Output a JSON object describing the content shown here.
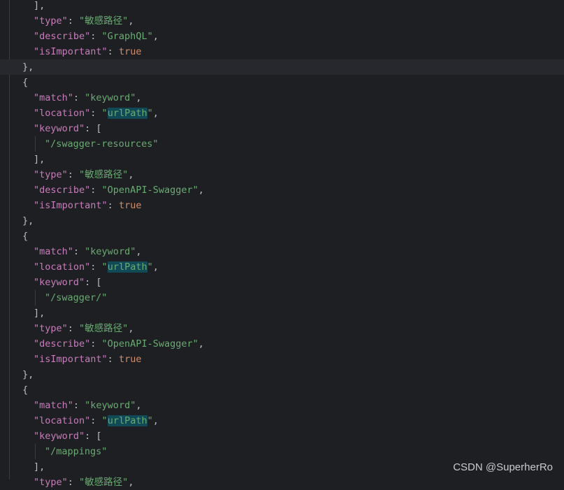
{
  "editor": {
    "lines": [
      {
        "indent": 1,
        "tokens": [
          {
            "t": "],",
            "c": "pun"
          }
        ]
      },
      {
        "indent": 1,
        "tokens": [
          {
            "t": "\"type\"",
            "c": "key"
          },
          {
            "t": ": ",
            "c": "pun"
          },
          {
            "t": "\"敏感路径\"",
            "c": "str"
          },
          {
            "t": ",",
            "c": "pun"
          }
        ]
      },
      {
        "indent": 1,
        "tokens": [
          {
            "t": "\"describe\"",
            "c": "key"
          },
          {
            "t": ": ",
            "c": "pun"
          },
          {
            "t": "\"GraphQL\"",
            "c": "str"
          },
          {
            "t": ",",
            "c": "pun"
          }
        ]
      },
      {
        "indent": 1,
        "tokens": [
          {
            "t": "\"isImportant\"",
            "c": "key"
          },
          {
            "t": ": ",
            "c": "pun"
          },
          {
            "t": "true",
            "c": "kw"
          }
        ]
      },
      {
        "indent": 0,
        "current": true,
        "tokens": [
          {
            "t": "},",
            "c": "pun"
          }
        ]
      },
      {
        "indent": 0,
        "tokens": [
          {
            "t": "{",
            "c": "pun"
          }
        ]
      },
      {
        "indent": 1,
        "tokens": [
          {
            "t": "\"match\"",
            "c": "key"
          },
          {
            "t": ": ",
            "c": "pun"
          },
          {
            "t": "\"keyword\"",
            "c": "str"
          },
          {
            "t": ",",
            "c": "pun"
          }
        ]
      },
      {
        "indent": 1,
        "tokens": [
          {
            "t": "\"location\"",
            "c": "key"
          },
          {
            "t": ": ",
            "c": "pun"
          },
          {
            "t": "\"",
            "c": "str"
          },
          {
            "t": "urlPath",
            "c": "str hl"
          },
          {
            "t": "\"",
            "c": "str"
          },
          {
            "t": ",",
            "c": "pun"
          }
        ]
      },
      {
        "indent": 1,
        "tokens": [
          {
            "t": "\"keyword\"",
            "c": "key"
          },
          {
            "t": ": [",
            "c": "pun"
          }
        ]
      },
      {
        "indent": 2,
        "tokens": [
          {
            "t": "\"/swagger-resources\"",
            "c": "str"
          }
        ]
      },
      {
        "indent": 1,
        "tokens": [
          {
            "t": "],",
            "c": "pun"
          }
        ]
      },
      {
        "indent": 1,
        "tokens": [
          {
            "t": "\"type\"",
            "c": "key"
          },
          {
            "t": ": ",
            "c": "pun"
          },
          {
            "t": "\"敏感路径\"",
            "c": "str"
          },
          {
            "t": ",",
            "c": "pun"
          }
        ]
      },
      {
        "indent": 1,
        "tokens": [
          {
            "t": "\"describe\"",
            "c": "key"
          },
          {
            "t": ": ",
            "c": "pun"
          },
          {
            "t": "\"OpenAPI-Swagger\"",
            "c": "str"
          },
          {
            "t": ",",
            "c": "pun"
          }
        ]
      },
      {
        "indent": 1,
        "tokens": [
          {
            "t": "\"isImportant\"",
            "c": "key"
          },
          {
            "t": ": ",
            "c": "pun"
          },
          {
            "t": "true",
            "c": "kw"
          }
        ]
      },
      {
        "indent": 0,
        "tokens": [
          {
            "t": "},",
            "c": "pun"
          }
        ]
      },
      {
        "indent": 0,
        "tokens": [
          {
            "t": "{",
            "c": "pun"
          }
        ]
      },
      {
        "indent": 1,
        "tokens": [
          {
            "t": "\"match\"",
            "c": "key"
          },
          {
            "t": ": ",
            "c": "pun"
          },
          {
            "t": "\"keyword\"",
            "c": "str"
          },
          {
            "t": ",",
            "c": "pun"
          }
        ]
      },
      {
        "indent": 1,
        "tokens": [
          {
            "t": "\"location\"",
            "c": "key"
          },
          {
            "t": ": ",
            "c": "pun"
          },
          {
            "t": "\"",
            "c": "str"
          },
          {
            "t": "urlPath",
            "c": "str hl"
          },
          {
            "t": "\"",
            "c": "str"
          },
          {
            "t": ",",
            "c": "pun"
          }
        ]
      },
      {
        "indent": 1,
        "tokens": [
          {
            "t": "\"keyword\"",
            "c": "key"
          },
          {
            "t": ": [",
            "c": "pun"
          }
        ]
      },
      {
        "indent": 2,
        "tokens": [
          {
            "t": "\"/swagger/\"",
            "c": "str"
          }
        ]
      },
      {
        "indent": 1,
        "tokens": [
          {
            "t": "],",
            "c": "pun"
          }
        ]
      },
      {
        "indent": 1,
        "tokens": [
          {
            "t": "\"type\"",
            "c": "key"
          },
          {
            "t": ": ",
            "c": "pun"
          },
          {
            "t": "\"敏感路径\"",
            "c": "str"
          },
          {
            "t": ",",
            "c": "pun"
          }
        ]
      },
      {
        "indent": 1,
        "tokens": [
          {
            "t": "\"describe\"",
            "c": "key"
          },
          {
            "t": ": ",
            "c": "pun"
          },
          {
            "t": "\"OpenAPI-Swagger\"",
            "c": "str"
          },
          {
            "t": ",",
            "c": "pun"
          }
        ]
      },
      {
        "indent": 1,
        "tokens": [
          {
            "t": "\"isImportant\"",
            "c": "key"
          },
          {
            "t": ": ",
            "c": "pun"
          },
          {
            "t": "true",
            "c": "kw"
          }
        ]
      },
      {
        "indent": 0,
        "tokens": [
          {
            "t": "},",
            "c": "pun"
          }
        ]
      },
      {
        "indent": 0,
        "tokens": [
          {
            "t": "{",
            "c": "pun"
          }
        ]
      },
      {
        "indent": 1,
        "tokens": [
          {
            "t": "\"match\"",
            "c": "key"
          },
          {
            "t": ": ",
            "c": "pun"
          },
          {
            "t": "\"keyword\"",
            "c": "str"
          },
          {
            "t": ",",
            "c": "pun"
          }
        ]
      },
      {
        "indent": 1,
        "tokens": [
          {
            "t": "\"location\"",
            "c": "key"
          },
          {
            "t": ": ",
            "c": "pun"
          },
          {
            "t": "\"",
            "c": "str"
          },
          {
            "t": "urlPath",
            "c": "str hl"
          },
          {
            "t": "\"",
            "c": "str"
          },
          {
            "t": ",",
            "c": "pun"
          }
        ]
      },
      {
        "indent": 1,
        "tokens": [
          {
            "t": "\"keyword\"",
            "c": "key"
          },
          {
            "t": ": [",
            "c": "pun"
          }
        ]
      },
      {
        "indent": 2,
        "tokens": [
          {
            "t": "\"/mappings\"",
            "c": "str"
          }
        ]
      },
      {
        "indent": 1,
        "tokens": [
          {
            "t": "],",
            "c": "pun"
          }
        ]
      },
      {
        "indent": 1,
        "tokens": [
          {
            "t": "\"type\"",
            "c": "key"
          },
          {
            "t": ": ",
            "c": "pun"
          },
          {
            "t": "\"敏感路径\"",
            "c": "str"
          },
          {
            "t": ",",
            "c": "pun"
          }
        ]
      }
    ]
  },
  "watermark": "CSDN @SuperherRo",
  "colors": {
    "background": "#1e1f22",
    "current_line": "#26282e",
    "json_key": "#c77dbb",
    "string": "#6aab73",
    "keyword": "#cf8e6d",
    "punctuation": "#bcbec4",
    "search_highlight": "#114957"
  }
}
